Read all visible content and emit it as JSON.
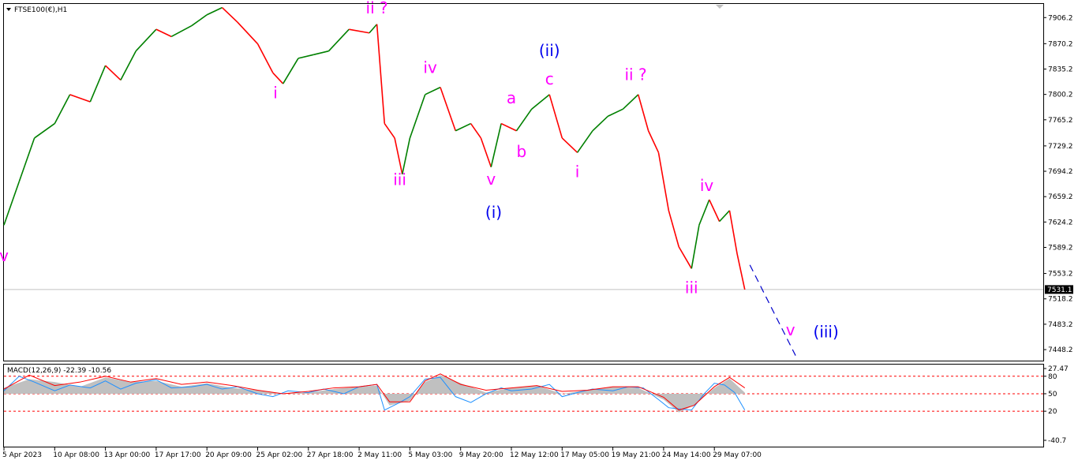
{
  "header": {
    "symbol_title": "FTSE100(€),H1",
    "macd_title": "MACD(12,26,9) -22.39 -10.56"
  },
  "price_axis": {
    "ticks": [
      "7906.2",
      "7870.2",
      "7835.2",
      "7800.2",
      "7765.2",
      "7729.2",
      "7694.2",
      "7659.2",
      "7624.2",
      "7589.2",
      "7553.2",
      "7518.2",
      "7483.2",
      "7448.2"
    ],
    "current_price": "7531.1"
  },
  "macd_axis": {
    "ticks": [
      "27.47",
      "80",
      "50",
      "20",
      "-40.7"
    ]
  },
  "time_axis": {
    "ticks": [
      "5 Apr 2023",
      "10 Apr 08:00",
      "13 Apr 00:00",
      "17 Apr 17:00",
      "20 Apr 09:00",
      "25 Apr 02:00",
      "27 Apr 18:00",
      "2 May 11:00",
      "5 May 03:00",
      "9 May 20:00",
      "12 May 12:00",
      "17 May 05:00",
      "19 May 21:00",
      "24 May 14:00",
      "29 May 07:00"
    ]
  },
  "wave_labels": [
    {
      "text": "v",
      "color": "#ff00ff",
      "price": 7570,
      "t": 0.0
    },
    {
      "text": "ii ?",
      "color": "#ff00ff",
      "price": 7912,
      "t": 7.35
    },
    {
      "text": "i",
      "color": "#ff00ff",
      "price": 7795,
      "t": 5.35
    },
    {
      "text": "iii",
      "color": "#ff00ff",
      "price": 7675,
      "t": 7.8
    },
    {
      "text": "iv",
      "color": "#ff00ff",
      "price": 7830,
      "t": 8.4
    },
    {
      "text": "v",
      "color": "#ff00ff",
      "price": 7676,
      "t": 9.6
    },
    {
      "text": "(i)",
      "color": "#0000ee",
      "price": 7630,
      "t": 9.65
    },
    {
      "text": "a",
      "color": "#ff00ff",
      "price": 7788,
      "t": 10.0
    },
    {
      "text": "b",
      "color": "#ff00ff",
      "price": 7714,
      "t": 10.2
    },
    {
      "text": "(ii)",
      "color": "#0000ee",
      "price": 7853,
      "t": 10.75
    },
    {
      "text": "c",
      "color": "#ff00ff",
      "price": 7814,
      "t": 10.75
    },
    {
      "text": "i",
      "color": "#ff00ff",
      "price": 7686,
      "t": 11.3
    },
    {
      "text": "ii ?",
      "color": "#ff00ff",
      "price": 7820,
      "t": 12.45
    },
    {
      "text": "iv",
      "color": "#ff00ff",
      "price": 7667,
      "t": 13.85
    },
    {
      "text": "iii",
      "color": "#ff00ff",
      "price": 7526,
      "t": 13.55
    },
    {
      "text": "v",
      "color": "#ff00ff",
      "price": 7468,
      "t": 15.5
    },
    {
      "text": "(iii)",
      "color": "#0000ee",
      "price": 7465,
      "t": 16.2
    }
  ],
  "chart_data": {
    "type": "line",
    "title": "FTSE100(€),H1",
    "x": [
      "5 Apr 2023",
      "10 Apr 08:00",
      "13 Apr 00:00",
      "17 Apr 17:00",
      "20 Apr 09:00",
      "25 Apr 02:00",
      "27 Apr 18:00",
      "2 May 11:00",
      "5 May 03:00",
      "9 May 20:00",
      "12 May 12:00",
      "17 May 05:00",
      "19 May 21:00",
      "24 May 14:00",
      "29 May 07:00"
    ],
    "price_series": {
      "name": "",
      "color_up": "#008000",
      "color_down": "#ff0000",
      "points": [
        [
          0.0,
          7620
        ],
        [
          0.3,
          7680
        ],
        [
          0.6,
          7740
        ],
        [
          1.0,
          7760
        ],
        [
          1.3,
          7800
        ],
        [
          1.7,
          7790
        ],
        [
          2.0,
          7840
        ],
        [
          2.3,
          7820
        ],
        [
          2.6,
          7860
        ],
        [
          3.0,
          7890
        ],
        [
          3.3,
          7880
        ],
        [
          3.7,
          7895
        ],
        [
          4.0,
          7910
        ],
        [
          4.3,
          7920
        ],
        [
          4.6,
          7900
        ],
        [
          5.0,
          7870
        ],
        [
          5.3,
          7830
        ],
        [
          5.5,
          7815
        ],
        [
          5.8,
          7850
        ],
        [
          6.1,
          7855
        ],
        [
          6.4,
          7860
        ],
        [
          6.8,
          7890
        ],
        [
          7.2,
          7885
        ],
        [
          7.35,
          7897
        ],
        [
          7.5,
          7760
        ],
        [
          7.7,
          7740
        ],
        [
          7.85,
          7690
        ],
        [
          8.0,
          7740
        ],
        [
          8.3,
          7800
        ],
        [
          8.6,
          7810
        ],
        [
          8.9,
          7750
        ],
        [
          9.2,
          7760
        ],
        [
          9.4,
          7740
        ],
        [
          9.6,
          7700
        ],
        [
          9.8,
          7760
        ],
        [
          10.1,
          7750
        ],
        [
          10.4,
          7780
        ],
        [
          10.75,
          7800
        ],
        [
          11.0,
          7740
        ],
        [
          11.3,
          7720
        ],
        [
          11.6,
          7750
        ],
        [
          11.9,
          7770
        ],
        [
          12.2,
          7780
        ],
        [
          12.5,
          7800
        ],
        [
          12.7,
          7750
        ],
        [
          12.9,
          7720
        ],
        [
          13.1,
          7640
        ],
        [
          13.3,
          7590
        ],
        [
          13.55,
          7560
        ],
        [
          13.7,
          7620
        ],
        [
          13.9,
          7655
        ],
        [
          14.1,
          7625
        ],
        [
          14.3,
          7640
        ],
        [
          14.45,
          7580
        ],
        [
          14.6,
          7531
        ]
      ]
    },
    "projection": {
      "from": [
        14.7,
        7565
      ],
      "to": [
        15.6,
        7440
      ],
      "color": "#0000cc",
      "style": "dashed"
    },
    "current_price": 7531.1,
    "ylim": [
      7433,
      7925
    ],
    "macd": {
      "title": "MACD(12,26,9) -22.39 -10.56",
      "histogram_value": -22.39,
      "signal_value": -10.56,
      "levels": [
        80,
        50,
        20
      ],
      "ylim": [
        -40.7,
        100
      ],
      "histogram": [
        [
          0,
          60
        ],
        [
          0.5,
          75
        ],
        [
          1.0,
          70
        ],
        [
          1.5,
          62
        ],
        [
          2.0,
          78
        ],
        [
          2.5,
          70
        ],
        [
          3.0,
          72
        ],
        [
          3.5,
          62
        ],
        [
          4.0,
          68
        ],
        [
          4.5,
          60
        ],
        [
          5.0,
          56
        ],
        [
          5.5,
          50
        ],
        [
          6.0,
          52
        ],
        [
          6.5,
          58
        ],
        [
          7.0,
          62
        ],
        [
          7.35,
          64
        ],
        [
          7.6,
          30
        ],
        [
          8.0,
          38
        ],
        [
          8.3,
          70
        ],
        [
          8.6,
          82
        ],
        [
          9.0,
          68
        ],
        [
          9.5,
          52
        ],
        [
          10.0,
          60
        ],
        [
          10.5,
          64
        ],
        [
          11.0,
          50
        ],
        [
          11.5,
          56
        ],
        [
          12.0,
          62
        ],
        [
          12.5,
          60
        ],
        [
          13.0,
          40
        ],
        [
          13.3,
          18
        ],
        [
          13.6,
          30
        ],
        [
          14.0,
          60
        ],
        [
          14.3,
          76
        ],
        [
          14.6,
          52
        ]
      ],
      "macd_line": [
        [
          0,
          55
        ],
        [
          0.3,
          80
        ],
        [
          0.6,
          70
        ],
        [
          1.0,
          55
        ],
        [
          1.3,
          65
        ],
        [
          1.7,
          60
        ],
        [
          2.0,
          72
        ],
        [
          2.3,
          58
        ],
        [
          2.6,
          68
        ],
        [
          3.0,
          74
        ],
        [
          3.3,
          60
        ],
        [
          3.7,
          62
        ],
        [
          4.0,
          66
        ],
        [
          4.3,
          58
        ],
        [
          4.6,
          62
        ],
        [
          5.0,
          50
        ],
        [
          5.3,
          45
        ],
        [
          5.6,
          55
        ],
        [
          6.0,
          52
        ],
        [
          6.3,
          58
        ],
        [
          6.7,
          50
        ],
        [
          7.0,
          62
        ],
        [
          7.35,
          66
        ],
        [
          7.5,
          22
        ],
        [
          7.8,
          35
        ],
        [
          8.0,
          45
        ],
        [
          8.3,
          75
        ],
        [
          8.6,
          78
        ],
        [
          8.9,
          45
        ],
        [
          9.2,
          35
        ],
        [
          9.5,
          50
        ],
        [
          9.8,
          60
        ],
        [
          10.0,
          55
        ],
        [
          10.4,
          58
        ],
        [
          10.75,
          66
        ],
        [
          11.0,
          45
        ],
        [
          11.3,
          52
        ],
        [
          11.6,
          58
        ],
        [
          12.0,
          55
        ],
        [
          12.3,
          62
        ],
        [
          12.6,
          60
        ],
        [
          12.9,
          40
        ],
        [
          13.1,
          26
        ],
        [
          13.3,
          24
        ],
        [
          13.55,
          22
        ],
        [
          13.8,
          50
        ],
        [
          14.0,
          68
        ],
        [
          14.2,
          65
        ],
        [
          14.4,
          52
        ],
        [
          14.6,
          22
        ]
      ],
      "signal_line": [
        [
          0,
          58
        ],
        [
          0.5,
          82
        ],
        [
          1.0,
          64
        ],
        [
          1.5,
          70
        ],
        [
          2.0,
          80
        ],
        [
          2.5,
          70
        ],
        [
          3.0,
          76
        ],
        [
          3.5,
          66
        ],
        [
          4.0,
          70
        ],
        [
          4.5,
          64
        ],
        [
          5.0,
          56
        ],
        [
          5.5,
          50
        ],
        [
          6.0,
          54
        ],
        [
          6.5,
          60
        ],
        [
          7.0,
          62
        ],
        [
          7.35,
          66
        ],
        [
          7.6,
          36
        ],
        [
          8.0,
          36
        ],
        [
          8.3,
          72
        ],
        [
          8.6,
          84
        ],
        [
          9.0,
          66
        ],
        [
          9.5,
          56
        ],
        [
          10.0,
          60
        ],
        [
          10.5,
          64
        ],
        [
          11.0,
          54
        ],
        [
          11.5,
          56
        ],
        [
          12.0,
          62
        ],
        [
          12.5,
          62
        ],
        [
          13.0,
          44
        ],
        [
          13.3,
          22
        ],
        [
          13.6,
          30
        ],
        [
          14.0,
          62
        ],
        [
          14.3,
          78
        ],
        [
          14.6,
          60
        ]
      ]
    }
  }
}
